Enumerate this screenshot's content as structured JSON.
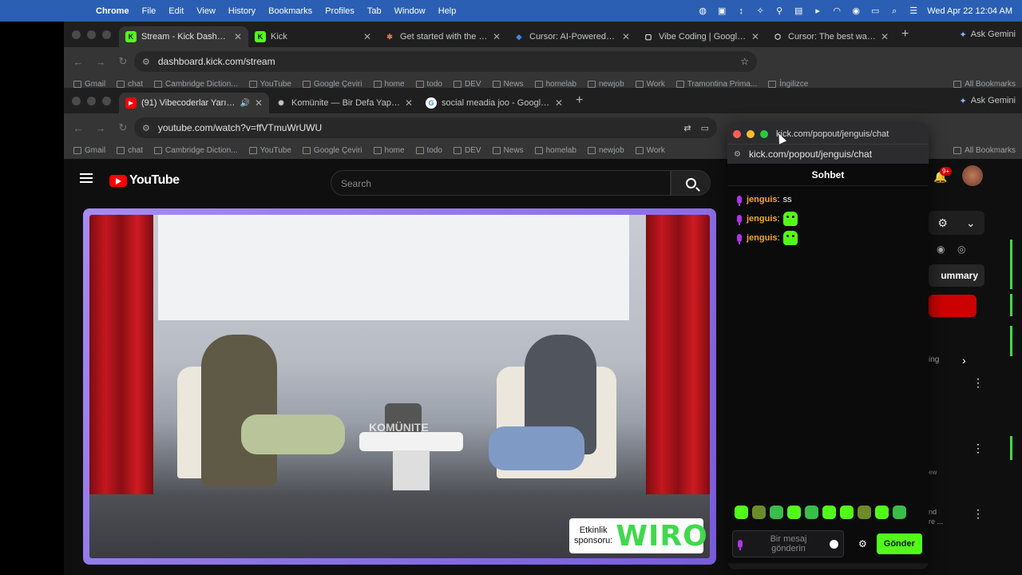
{
  "menubar": {
    "app": "Chrome",
    "items": [
      "File",
      "Edit",
      "View",
      "History",
      "Bookmarks",
      "Profiles",
      "Tab",
      "Window",
      "Help"
    ],
    "datetime": "Wed Apr 22  12:04 AM"
  },
  "window_back": {
    "tabs": [
      {
        "title": "Stream - Kick Dashboard",
        "fav": "K",
        "favcolor": "#53fc18"
      },
      {
        "title": "Kick",
        "fav": "K",
        "favcolor": "#53fc18"
      },
      {
        "title": "Get started with the de",
        "fav": "✱",
        "favcolor": "#d97757"
      },
      {
        "title": "Cursor: AI-Powered Co",
        "fav": "◆",
        "favcolor": "#4285f4"
      },
      {
        "title": "Vibe Coding | Google A",
        "fav": "▢",
        "favcolor": "#ffffff"
      },
      {
        "title": "Cursor: The best way to",
        "fav": "⬡",
        "favcolor": "#ffffff"
      }
    ],
    "url": "dashboard.kick.com/stream",
    "ask_gemini": "Ask Gemini",
    "bookmarks": [
      "Gmail",
      "chat",
      "Cambridge Diction...",
      "YouTube",
      "Google Çeviri",
      "home",
      "todo",
      "DEV",
      "News",
      "homelab",
      "newjob",
      "Work",
      "Tramontina Prima...",
      "İngilizce"
    ],
    "all_bookmarks": "All Bookmarks"
  },
  "window_front": {
    "tabs": [
      {
        "title": "(91) Vibecoderlar Yarışıyo",
        "fav": "▶",
        "favcolor": "#ff0000"
      },
      {
        "title": "Komünite — Bir Defa Yap, Her",
        "fav": "✺",
        "favcolor": "#ffffff"
      },
      {
        "title": "social meadia joo - Google'da",
        "fav": "G",
        "favcolor": "#4285f4"
      }
    ],
    "url": "youtube.com/watch?v=ffVTmuWrUWU",
    "ask_gemini": "Ask Gemini",
    "bookmarks": [
      "Gmail",
      "chat",
      "Cambridge Diction...",
      "YouTube",
      "Google Çeviri",
      "home",
      "todo",
      "DEV",
      "News",
      "homelab",
      "newjob",
      "Work"
    ],
    "all_bookmarks": "All Bookmarks"
  },
  "youtube": {
    "logo": "YouTube",
    "search_placeholder": "Search",
    "notif_badge": "9+",
    "summary": "ummary",
    "ing": "ing",
    "ew": "ew",
    "nd_line1": "nd",
    "nd_line2": "re ...",
    "sponsor_label": "Etkinlik sponsoru:",
    "sponsor_brand": "WIRO",
    "stage_sign": "KOMÜNITE"
  },
  "popout": {
    "title": "kick.com/popout/jenguis/chat",
    "url": "kick.com/popout/jenguis/chat",
    "chat_header": "Sohbet",
    "messages": [
      {
        "user": "jenguis",
        "text": "ss",
        "emote": false
      },
      {
        "user": "jenguis",
        "text": "",
        "emote": true
      },
      {
        "user": "jenguis",
        "text": "",
        "emote": true
      }
    ],
    "input_placeholder": "Bir mesaj gönderin",
    "send_label": "Gönder"
  },
  "colors": {
    "kick_green": "#53fc18",
    "username": "#f5a623",
    "yt_red": "#ff0000"
  }
}
